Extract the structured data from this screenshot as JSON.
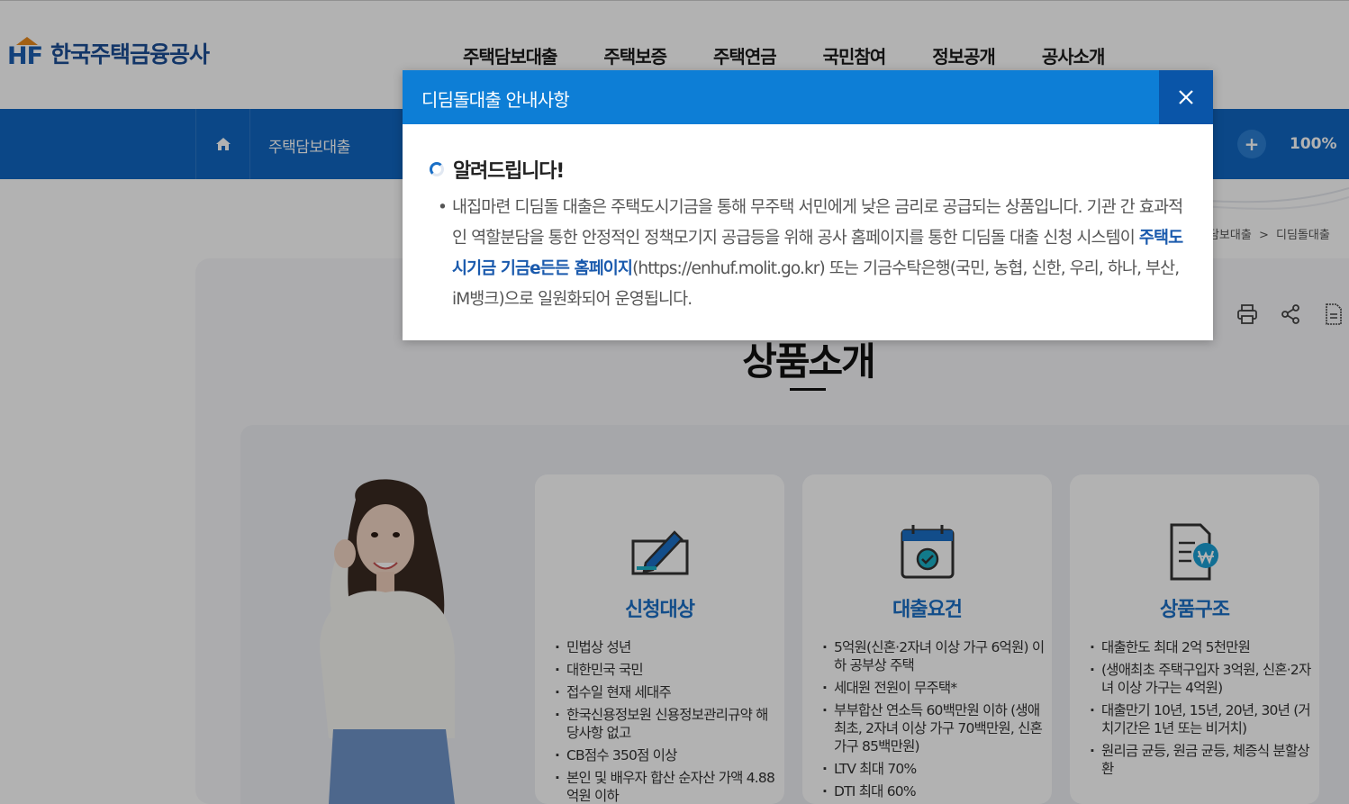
{
  "header": {
    "logo_text": "한국주택금융공사",
    "logo_mark": "HF",
    "nav": [
      "주택담보대출",
      "주택보증",
      "주택연금",
      "국민참여",
      "정보공개",
      "공사소개"
    ]
  },
  "subbar": {
    "crumb": "주택담보대출",
    "zoom_plus": "+",
    "zoom_level": "100%"
  },
  "breadcrumb": {
    "parent": "택담보대출",
    "separator": ">",
    "current": "디딤돌대출"
  },
  "page": {
    "title": "상품소개"
  },
  "cards": [
    {
      "title": "신청대상",
      "icon": "pen-form-icon",
      "items": [
        "민법상 성년",
        "대한민국 국민",
        "접수일 현재 세대주",
        "한국신용정보원 신용정보관리규약 해당사항 없고",
        "CB점수 350점 이상",
        "본인 및 배우자 합산 순자산 가액 4.88억원 이하"
      ]
    },
    {
      "title": "대출요건",
      "icon": "calendar-check-icon",
      "items": [
        "5억원(신혼·2자녀 이상 가구 6억원) 이하 공부상 주택",
        "세대원 전원이 무주택*",
        "부부합산 연소득 60백만원 이하 (생애최초, 2자녀 이상 가구 70백만원, 신혼가구 85백만원)",
        "LTV 최대 70%",
        "DTI 최대 60%"
      ]
    },
    {
      "title": "상품구조",
      "icon": "document-won-icon",
      "items": [
        "대출한도 최대 2억 5천만원",
        "(생애최초 주택구입자 3억원, 신혼·2자녀 이상 가구는 4억원)",
        "대출만기 10년, 15년, 20년, 30년 (거치기간은 1년 또는 비거치)",
        "원리금 균등, 원금 균등, 체증식 분할상환"
      ]
    }
  ],
  "modal": {
    "title": "디딤돌대출 안내사항",
    "close_label": "닫기",
    "notice_title": "알려드립니다!",
    "bullet": "•",
    "body_part1": "내집마련 디딤돌 대출은 주택도시기금을 통해 무주택 서민에게 낮은 금리로 공급되는 상품입니다. 기관 간 효과적인 역할분담을 통한 안정적인 정책모기지 공급등을 위해 공사 홈페이지를 통한 디딤돌 대출 신청 시스템이 ",
    "link_text": "주택도시기금 기금e든든 홈페이지",
    "body_part2": "(https://enhuf.molit.go.kr) 또는 기금수탁은행(국민, 농협, 신한, 우리, 하나, 부산, iM뱅크)으로 일원화되어 운영됩니다."
  },
  "colors": {
    "brand_blue": "#1066c2",
    "modal_header": "#0d7ed6",
    "modal_close": "#0a55a8",
    "card_title": "#1a6fc6",
    "logo_roof": "#e98a1e"
  }
}
